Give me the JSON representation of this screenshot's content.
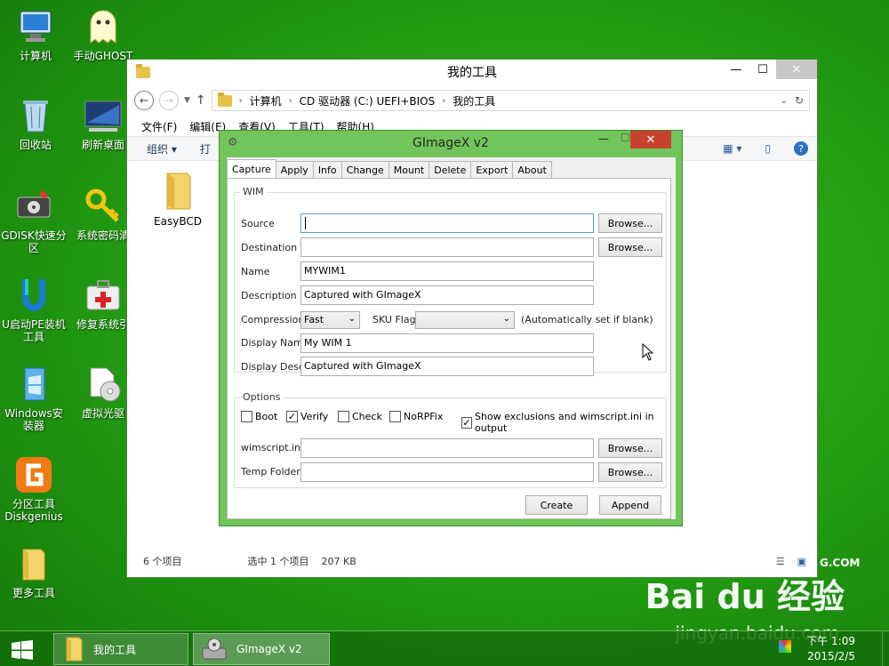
{
  "desktop": {
    "icons": [
      {
        "label": "计算机"
      },
      {
        "label": "手动GHOST"
      },
      {
        "label": "回收站"
      },
      {
        "label": "刷新桌面"
      },
      {
        "label": "GDISK快速分区"
      },
      {
        "label": "系统密码清"
      },
      {
        "label": "U启动PE装机工具"
      },
      {
        "label": "修复系统引"
      },
      {
        "label": "Windows安装器"
      },
      {
        "label": "虚拟光驱"
      },
      {
        "label": "分区工具Diskgenius"
      },
      {
        "label": "更多工具"
      }
    ],
    "watermark": {
      "baidu": "Bai du 经验",
      "url": "jingyan.baidu.com",
      "brand_fragment": "G.COM"
    }
  },
  "explorer": {
    "title": "我的工具",
    "breadcrumb": [
      "计算机",
      "CD 驱动器 (C:) UEFI+BIOS",
      "我的工具"
    ],
    "menu": [
      "文件(F)",
      "编辑(E)",
      "查看(V)",
      "工具(T)",
      "帮助(H)"
    ],
    "cmd_organize": "组织 ▾",
    "cmd_open": "打",
    "files": [
      {
        "name": "EasyBCD"
      }
    ],
    "status": {
      "count": "6 个项目",
      "selected": "选中 1 个项目",
      "size": "207 KB"
    }
  },
  "gimagex": {
    "title": "GImageX v2",
    "tabs": [
      "Capture",
      "Apply",
      "Info",
      "Change",
      "Mount",
      "Delete",
      "Export",
      "About"
    ],
    "wim_group": "WIM",
    "source_label": "Source",
    "source_value": "",
    "destination_label": "Destination",
    "destination_value": "",
    "name_label": "Name",
    "name_value": "MYWIM1",
    "description_label": "Description",
    "description_value": "Captured with GImageX",
    "compression_label": "Compression",
    "compression_value": "Fast",
    "skuflag_label": "SKU Flag",
    "skuflag_value": "",
    "skuflag_hint": "(Automatically set if blank)",
    "display_name_label": "Display Name",
    "display_name_value": "My WIM 1",
    "display_desc_label": "Display Desc.",
    "display_desc_value": "Captured with GImageX",
    "browse_label": "Browse...",
    "options_group": "Options",
    "options": [
      {
        "label": "Boot",
        "checked": false
      },
      {
        "label": "Verify",
        "checked": true
      },
      {
        "label": "Check",
        "checked": false
      },
      {
        "label": "NoRPFix",
        "checked": false
      },
      {
        "label": "Show exclusions and wimscript.ini in output",
        "checked": true
      }
    ],
    "wimscript_label": "wimscript.ini",
    "wimscript_value": "",
    "tempfolder_label": "Temp Folder",
    "tempfolder_value": "",
    "create_label": "Create",
    "append_label": "Append"
  },
  "taskbar": {
    "items": [
      {
        "label": "我的工具"
      },
      {
        "label": "GImageX v2"
      }
    ],
    "time": "下午 1:09",
    "date": "2015/2/5"
  },
  "colors": {
    "desktop": "#229a12",
    "dialog_frame": "#72c55a",
    "close": "#c7412f"
  }
}
